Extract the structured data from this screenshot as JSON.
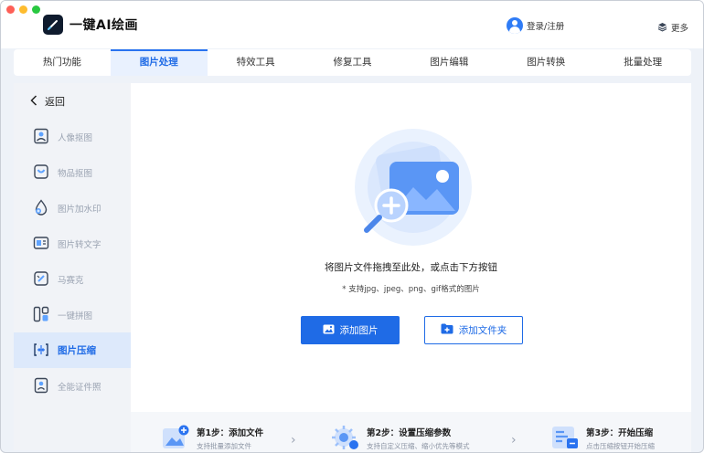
{
  "app": {
    "title": "一键AI绘画"
  },
  "header": {
    "login_label": "登录/注册",
    "more_label": "更多"
  },
  "tabs": [
    {
      "label": "热门功能"
    },
    {
      "label": "图片处理"
    },
    {
      "label": "特效工具"
    },
    {
      "label": "修复工具"
    },
    {
      "label": "图片编辑"
    },
    {
      "label": "图片转换"
    },
    {
      "label": "批量处理"
    }
  ],
  "sidebar": {
    "back_label": "返回",
    "items": [
      {
        "label": "人像抠图",
        "icon": "portrait-cutout-icon"
      },
      {
        "label": "物品抠图",
        "icon": "object-cutout-icon"
      },
      {
        "label": "图片加水印",
        "icon": "watermark-icon"
      },
      {
        "label": "图片转文字",
        "icon": "image-to-text-icon"
      },
      {
        "label": "马赛克",
        "icon": "mosaic-icon"
      },
      {
        "label": "一键拼图",
        "icon": "collage-icon"
      },
      {
        "label": "图片压缩",
        "icon": "compress-icon",
        "active": true
      },
      {
        "label": "全能证件照",
        "icon": "id-photo-icon"
      }
    ]
  },
  "main": {
    "drop_text": "将图片文件拖拽至此处，或点击下方按钮",
    "hint_text": "* 支持jpg、jpeg、png、gif格式的图片",
    "add_image_label": "添加图片",
    "add_folder_label": "添加文件夹"
  },
  "steps": [
    {
      "title": "第1步：添加文件",
      "desc": "支持批量添加文件"
    },
    {
      "title": "第2步：设置压缩参数",
      "desc": "支持自定义压缩、缩小优先等模式"
    },
    {
      "title": "第3步：开始压缩",
      "desc": "点击压缩按钮开始压缩"
    }
  ],
  "colors": {
    "accent": "#1f6be6",
    "sidebar_active_bg": "#dde9fb",
    "muted_text": "#9aa3b2"
  }
}
